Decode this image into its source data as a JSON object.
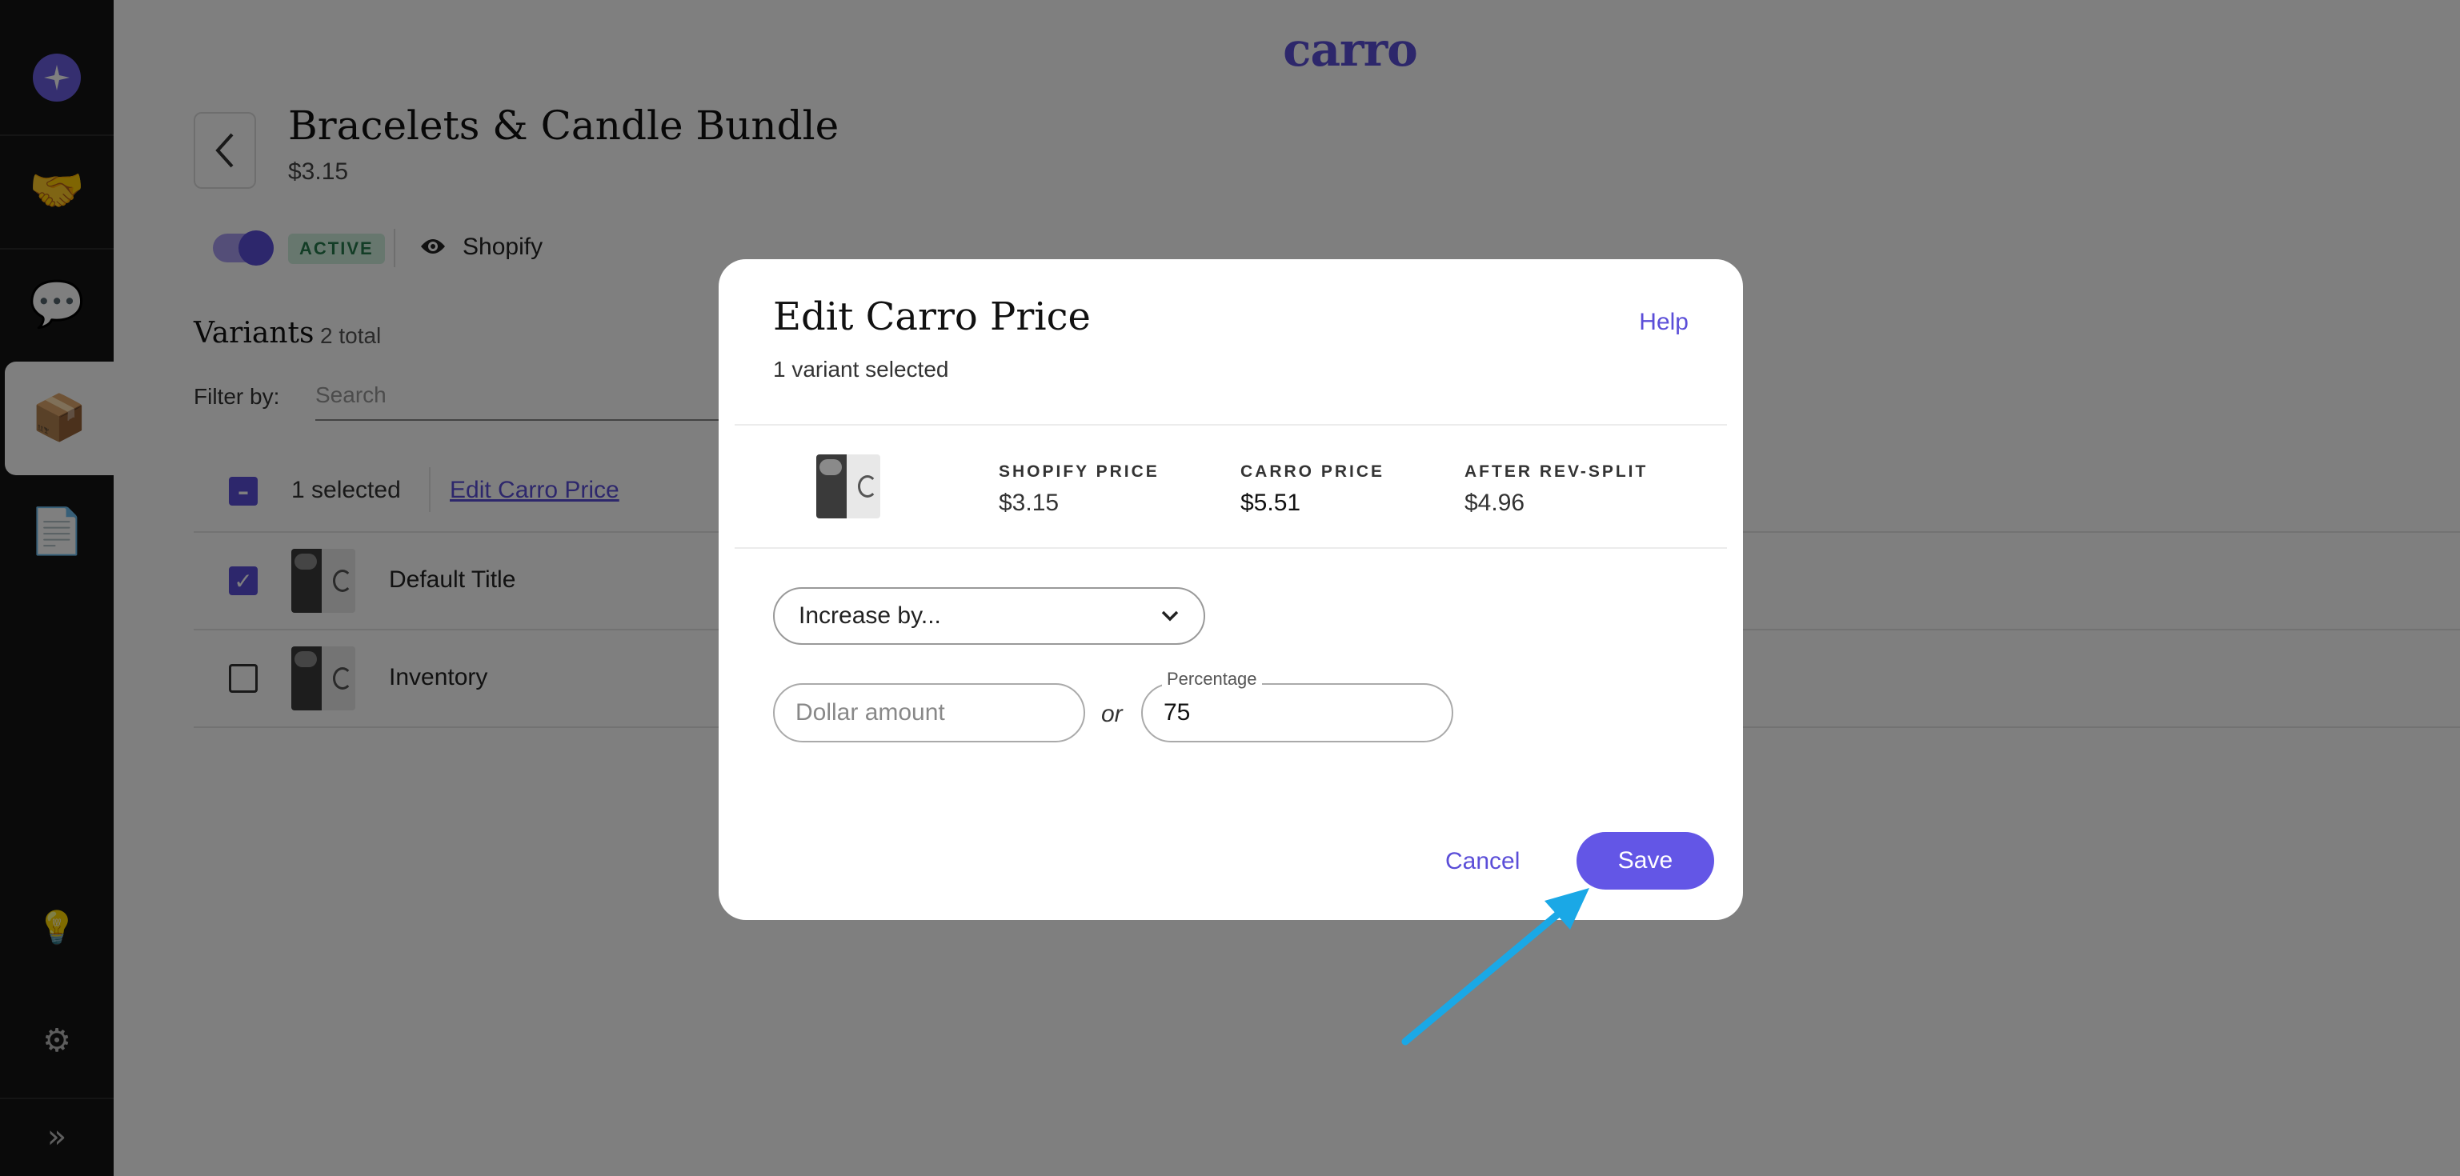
{
  "brand": "carro",
  "sidebar": {
    "items": [
      {
        "icon": "sparkle-logo-icon"
      },
      {
        "icon": "handshake-icon",
        "glyph": "🤝"
      },
      {
        "icon": "chat-bubble-icon",
        "glyph": "💬"
      },
      {
        "icon": "box-icon",
        "glyph": "📦",
        "active": true
      },
      {
        "icon": "document-icon",
        "glyph": "📄"
      },
      {
        "icon": "lightbulb-icon",
        "glyph": "💡"
      },
      {
        "icon": "gear-icon",
        "glyph": "⚙"
      },
      {
        "icon": "expand-chevrons-icon",
        "glyph": "»"
      }
    ]
  },
  "product": {
    "title": "Bracelets & Candle Bundle",
    "price": "$3.15",
    "status": "ACTIVE",
    "channel": "Shopify"
  },
  "variants": {
    "heading": "Variants",
    "count": "2 total",
    "filter_label": "Filter by:",
    "search_placeholder": "Search",
    "selected_text": "1 selected",
    "edit_link": "Edit Carro Price",
    "rows": [
      {
        "label": "Default Title",
        "checked": true
      },
      {
        "label": "Inventory",
        "checked": false
      }
    ]
  },
  "modal": {
    "title": "Edit Carro Price",
    "subtitle": "1 variant selected",
    "help": "Help",
    "columns": [
      {
        "header": "SHOPIFY PRICE",
        "value": "$3.15"
      },
      {
        "header": "CARRO PRICE",
        "value": "$5.51"
      },
      {
        "header": "AFTER REV-SPLIT",
        "value": "$4.96"
      }
    ],
    "select_value": "Increase by...",
    "dollar_placeholder": "Dollar amount",
    "or_text": "or",
    "percentage_label": "Percentage",
    "percentage_value": "75",
    "cancel": "Cancel",
    "save": "Save"
  },
  "colors": {
    "accent": "#6356e6",
    "sidebar_bg": "#141414",
    "arrow": "#1aa8e6"
  }
}
